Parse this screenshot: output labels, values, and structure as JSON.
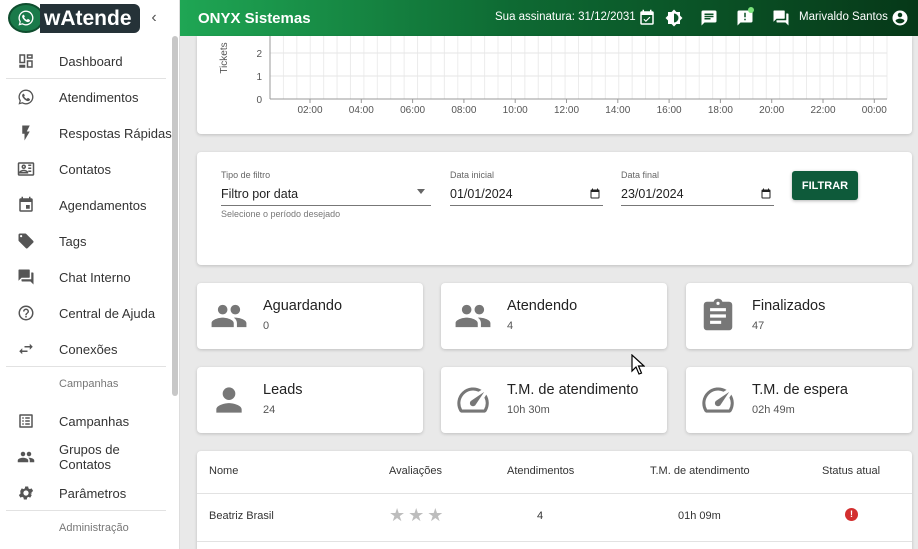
{
  "brand": {
    "name": "wAtende",
    "collapse_icon": "chevron-left-icon"
  },
  "sidebar": {
    "items": [
      {
        "label": "Dashboard",
        "icon": "dashboard-icon"
      },
      {
        "label": "Atendimentos",
        "icon": "whatsapp-icon"
      },
      {
        "label": "Respostas Rápidas",
        "icon": "flash-icon"
      },
      {
        "label": "Contatos",
        "icon": "contact-card-icon"
      },
      {
        "label": "Agendamentos",
        "icon": "calendar-icon"
      },
      {
        "label": "Tags",
        "icon": "tag-icon"
      },
      {
        "label": "Chat Interno",
        "icon": "forum-icon"
      },
      {
        "label": "Central de Ajuda",
        "icon": "help-icon"
      },
      {
        "label": "Conexões",
        "icon": "sync-arrows-icon"
      }
    ],
    "section_campanhas": "Campanhas",
    "items2": [
      {
        "label": "Campanhas",
        "icon": "list-icon"
      },
      {
        "label": "Grupos de Contatos",
        "icon": "people-icon"
      },
      {
        "label": "Parâmetros",
        "icon": "gear-icon"
      }
    ],
    "section_admin": "Administração"
  },
  "topbar": {
    "title": "ONYX Sistemas",
    "subscription": "Sua assinatura: 31/12/2031",
    "user_name": "Marivaldo Santos",
    "colors": {
      "start": "#1fa654",
      "end": "#063818"
    }
  },
  "chart_data": {
    "type": "line",
    "ylabel": "Tickets",
    "y_ticks": [
      "0",
      "1",
      "2"
    ],
    "x_ticks": [
      "02:00",
      "04:00",
      "06:00",
      "08:00",
      "10:00",
      "12:00",
      "14:00",
      "16:00",
      "18:00",
      "20:00",
      "22:00",
      "00:00"
    ],
    "grid": true
  },
  "filter": {
    "type_label": "Tipo de filtro",
    "type_value": "Filtro por data",
    "type_help": "Selecione o período desejado",
    "start_label": "Data inicial",
    "start_value": "01/01/2024",
    "end_label": "Data final",
    "end_value": "23/01/2024",
    "button": "FILTRAR"
  },
  "stats": [
    {
      "title": "Aguardando",
      "value": "0",
      "icon": "group-icon"
    },
    {
      "title": "Atendendo",
      "value": "4",
      "icon": "group-icon"
    },
    {
      "title": "Finalizados",
      "value": "47",
      "icon": "clipboard-icon"
    },
    {
      "title": "Leads",
      "value": "24",
      "icon": "person-icon"
    },
    {
      "title": "T.M. de atendimento",
      "value": "10h 30m",
      "icon": "speedometer-icon"
    },
    {
      "title": "T.M. de espera",
      "value": "02h 49m",
      "icon": "speedometer-icon"
    }
  ],
  "table": {
    "headers": [
      "Nome",
      "Avaliações",
      "Atendimentos",
      "T.M. de atendimento",
      "Status atual"
    ],
    "rows": [
      {
        "name": "Beatriz Brasil",
        "rating": 0,
        "atendimentos": "4",
        "tm": "01h 09m",
        "status": "offline"
      }
    ],
    "status_color": "#d32f2f"
  }
}
